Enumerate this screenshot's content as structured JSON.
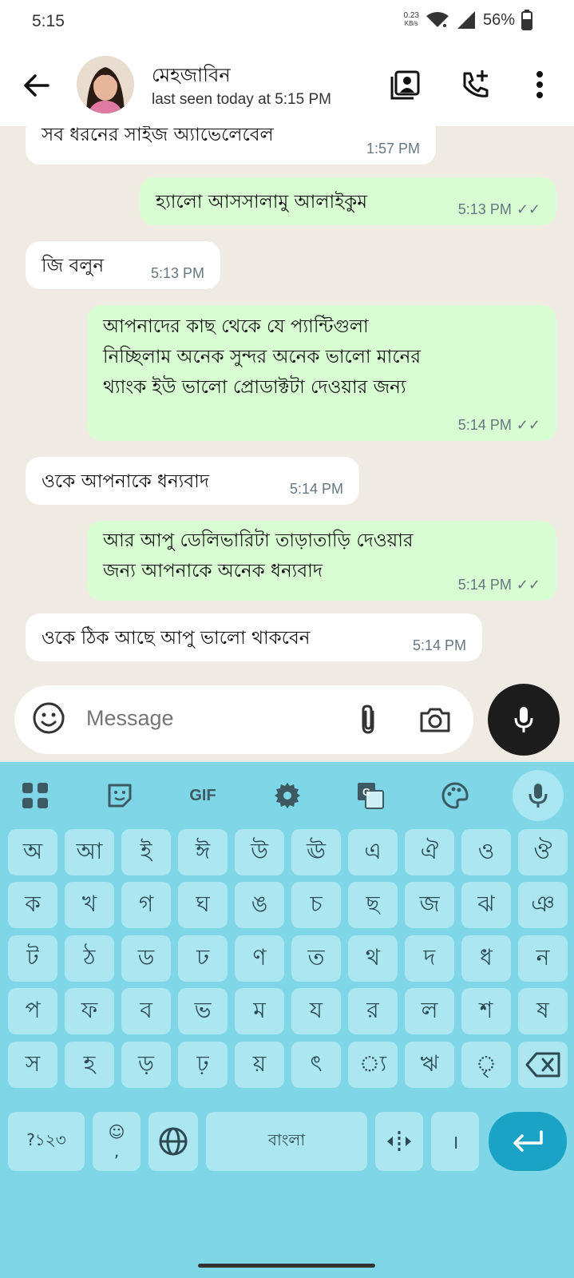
{
  "status_bar": {
    "time": "5:15",
    "net_speed_value": "0.23",
    "net_speed_unit": "KB/s",
    "battery": "56%"
  },
  "header": {
    "contact_name": "মেহজাবিন",
    "last_seen": "last seen today at 5:15 PM",
    "icons": [
      "back-arrow-icon",
      "video-call-icon",
      "add-call-icon",
      "more-vert-icon"
    ]
  },
  "messages": [
    {
      "direction": "in",
      "text": "সব ধরনের সাইজ অ্যাভেলেবেল",
      "time": "1:57 PM"
    },
    {
      "direction": "out",
      "text": "হ্যালো আসসালামু আলাইকুম",
      "time": "5:13 PM",
      "read": true
    },
    {
      "direction": "in",
      "text": "জি বলুন",
      "time": "5:13 PM"
    },
    {
      "direction": "out",
      "lines": [
        "আপনাদের কাছ থেকে যে প্যান্টিগুলা",
        "নিচ্ছিলাম অনেক সুন্দর অনেক ভালো মানের",
        "থ্যাংক ইউ ভালো প্রোডাক্টটা দেওয়ার জন্য"
      ],
      "time": "5:14 PM",
      "read": true
    },
    {
      "direction": "in",
      "text": "ওকে আপনাকে ধন্যবাদ",
      "time": "5:14 PM"
    },
    {
      "direction": "out",
      "lines": [
        "আর আপু ডেলিভারিটা তাড়াতাড়ি দেওয়ার",
        "জন্য আপনাকে অনেক ধন্যবাদ"
      ],
      "time": "5:14 PM",
      "read": true
    },
    {
      "direction": "in",
      "text": "ওকে ঠিক আছে আপু ভালো থাকবেন",
      "time": "5:14 PM"
    }
  ],
  "input": {
    "placeholder": "Message"
  },
  "keyboard": {
    "toolbar": {
      "gif_label": "GIF"
    },
    "rows": [
      [
        "অ",
        "আ",
        "ই",
        "ঈ",
        "উ",
        "ঊ",
        "এ",
        "ঐ",
        "ও",
        "ঔ"
      ],
      [
        "ক",
        "খ",
        "গ",
        "ঘ",
        "ঙ",
        "চ",
        "ছ",
        "জ",
        "ঝ",
        "ঞ"
      ],
      [
        "ট",
        "ঠ",
        "ড",
        "ঢ",
        "ণ",
        "ত",
        "থ",
        "দ",
        "ধ",
        "ন"
      ],
      [
        "প",
        "ফ",
        "ব",
        "ভ",
        "ম",
        "য",
        "র",
        "ল",
        "শ",
        "ষ"
      ],
      [
        "স",
        "হ",
        "ড়",
        "ঢ়",
        "য়",
        "ৎ",
        "্য",
        "ঋ",
        "ৃ"
      ]
    ],
    "bottom": {
      "symbols": "?১২৩",
      "emoji_comma": ",",
      "space": "বাংলা",
      "danda": "।"
    }
  }
}
